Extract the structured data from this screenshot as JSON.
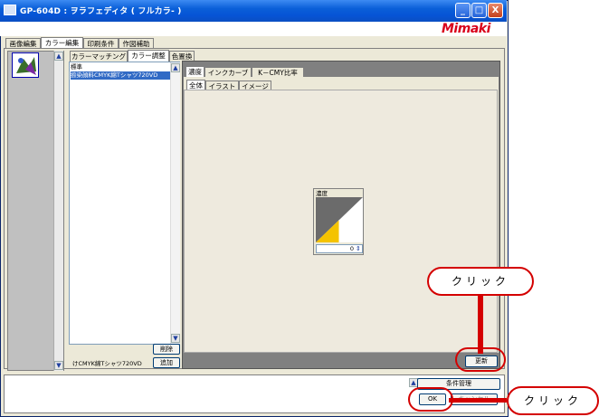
{
  "window": {
    "title": "GP-604D : ヲラフェディタ ( フルカラ- )"
  },
  "titlebar_buttons": {
    "minimize": "_",
    "maximize": "□",
    "close": "X"
  },
  "logo": {
    "text": "Mimaki",
    "color": "#d9001b"
  },
  "main_tabs": [
    "画像編集",
    "カラー編集",
    "印刷条件",
    "作図補助"
  ],
  "color_tabs": [
    "カラーマッチング",
    "カラー調整",
    "色置換"
  ],
  "color_list": {
    "items": [
      "標準",
      "捺染顔料CMYK綿Tシャツ720VD"
    ],
    "selected_index": 1
  },
  "list_buttons": {
    "delete": "削除",
    "add": "追加"
  },
  "profile_text": "けCMYK綿Tシャツ720VD",
  "adjust_tabs": [
    "濃度",
    "インクカーブ",
    "K－CMY比率"
  ],
  "sub_tabs": [
    "全体",
    "イラスト",
    "イメージ"
  ],
  "density": {
    "label": "濃度",
    "value": "0"
  },
  "update_button": "更新",
  "bottom": {
    "condition_button": "条件管理",
    "ok_button": "OK",
    "cancel_button": "キャンセル"
  },
  "callouts": {
    "top": "クリック",
    "bottom": "クリック"
  },
  "accent_color": "#d40000"
}
